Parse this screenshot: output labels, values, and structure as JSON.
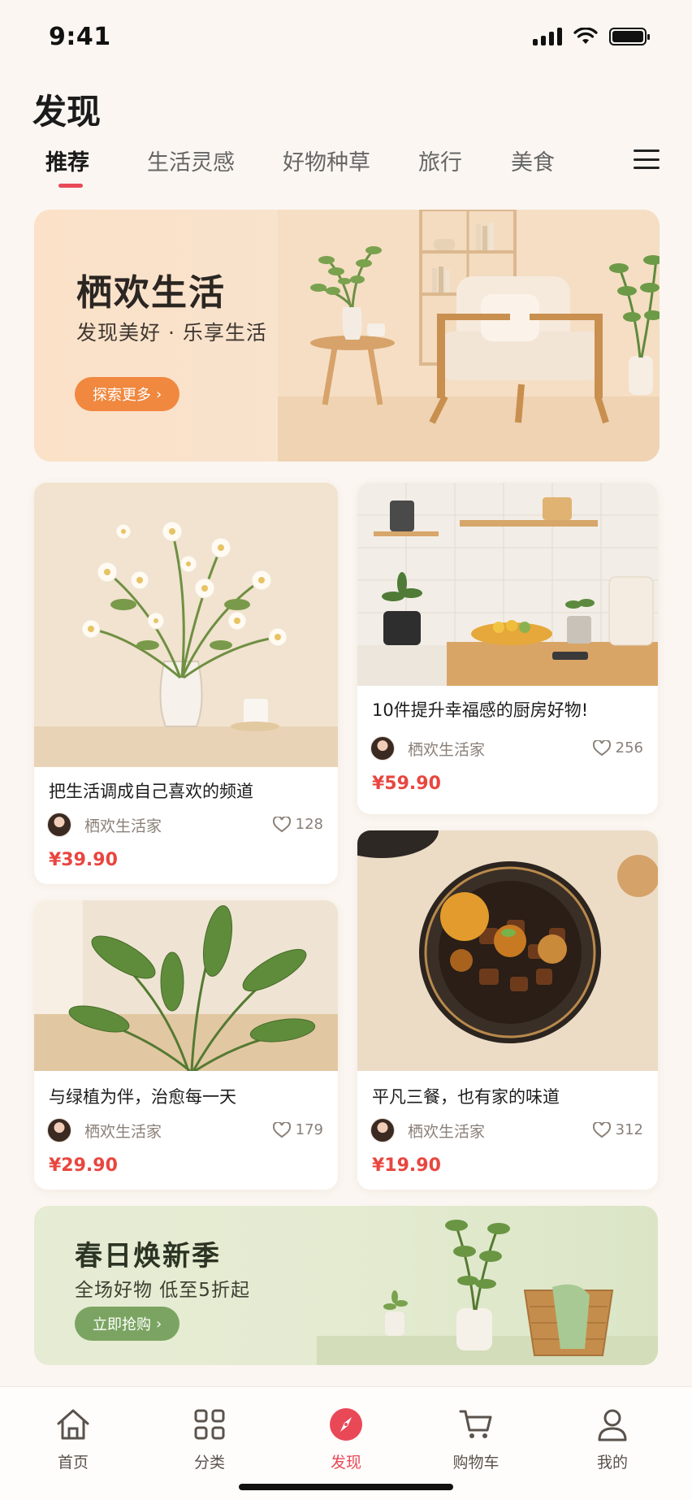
{
  "status": {
    "time": "9:41"
  },
  "page": {
    "title": "发现"
  },
  "tabs": [
    {
      "label": "推荐",
      "active": true
    },
    {
      "label": "生活灵感"
    },
    {
      "label": "好物种草"
    },
    {
      "label": "旅行"
    },
    {
      "label": "美食"
    }
  ],
  "banner": {
    "title": "栖欢生活",
    "subtitle": "发现美好 · 乐享生活",
    "button": "探索更多"
  },
  "cards": [
    {
      "title": "把生活调成自己喜欢的频道",
      "author": "栖欢生活家",
      "likes": "128",
      "price": "¥39.90"
    },
    {
      "title": "10件提升幸福感的厨房好物!",
      "author": "栖欢生活家",
      "likes": "256",
      "price": "¥59.90"
    },
    {
      "title": "与绿植为伴，治愈每一天",
      "author": "栖欢生活家",
      "likes": "179",
      "price": "¥29.90"
    },
    {
      "title": "平凡三餐，也有家的味道",
      "author": "栖欢生活家",
      "likes": "312",
      "price": "¥19.90"
    }
  ],
  "promo": {
    "title": "春日焕新季",
    "subtitle": "全场好物  低至5折起",
    "button": "立即抢购"
  },
  "tabbar": [
    {
      "label": "首页",
      "icon": "home-icon"
    },
    {
      "label": "分类",
      "icon": "grid-icon"
    },
    {
      "label": "发现",
      "icon": "compass-icon",
      "active": true
    },
    {
      "label": "购物车",
      "icon": "cart-icon"
    },
    {
      "label": "我的",
      "icon": "user-icon"
    }
  ],
  "colors": {
    "accent": "#e94857",
    "banner_button": "#f0883f",
    "promo_button": "#7ba462",
    "price": "#e8463f"
  }
}
